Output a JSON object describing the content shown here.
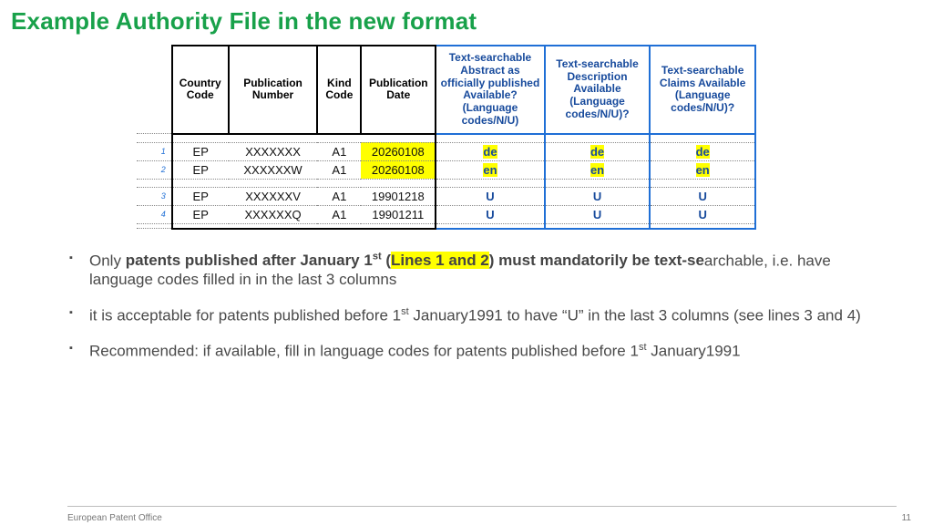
{
  "title": "Example Authority File in the new format",
  "table": {
    "headers": {
      "country_code": "Country Code",
      "publication_number": "Publication Number",
      "kind_code": "Kind Code",
      "publication_date": "Publication Date",
      "abstract_avail": "Text-searchable Abstract as officially published Available? (Language codes/N/U)",
      "descr_avail": "Text-searchable Description Available (Language codes/N/U)?",
      "claims_avail": "Text-searchable Claims Available (Language codes/N/U)?"
    },
    "rows": [
      {
        "n": "1",
        "cc": "EP",
        "pn": "XXXXXXX",
        "kc": "A1",
        "pd": "20260108",
        "a": "de",
        "d": "de",
        "c": "de",
        "hl_pd": true,
        "hl_adc": true
      },
      {
        "n": "2",
        "cc": "EP",
        "pn": "XXXXXXW",
        "kc": "A1",
        "pd": "20260108",
        "a": "en",
        "d": "en",
        "c": "en",
        "hl_pd": true,
        "hl_adc": true
      },
      {
        "n": "3",
        "cc": "EP",
        "pn": "XXXXXXV",
        "kc": "A1",
        "pd": "19901218",
        "a": "U",
        "d": "U",
        "c": "U",
        "hl_pd": false,
        "hl_adc": false
      },
      {
        "n": "4",
        "cc": "EP",
        "pn": "XXXXXXQ",
        "kc": "A1",
        "pd": "19901211",
        "a": "U",
        "d": "U",
        "c": "U",
        "hl_pd": false,
        "hl_adc": false
      }
    ]
  },
  "bullets": {
    "b1_plain1": "Only ",
    "b1_bold1": "patents published after January 1",
    "b1_sup": "st",
    "b1_bold2_open": " (",
    "b1_lines": "Lines 1 and 2",
    "b1_bold2_close": ") must mandatorily be text-se",
    "b1_plain2": "archable, i.e. have language codes filled in in the last 3 columns",
    "b2_a": "it is acceptable for patents published before 1",
    "b2_sup": "st",
    "b2_b": " January1991 to have “U” in the last 3 columns (see lines 3 and 4)",
    "b3_a": "Recommended: if available, fill in language codes for patents published before 1",
    "b3_sup": "st",
    "b3_b": " January1991"
  },
  "footer": {
    "org": "European Patent Office",
    "page": "11"
  }
}
